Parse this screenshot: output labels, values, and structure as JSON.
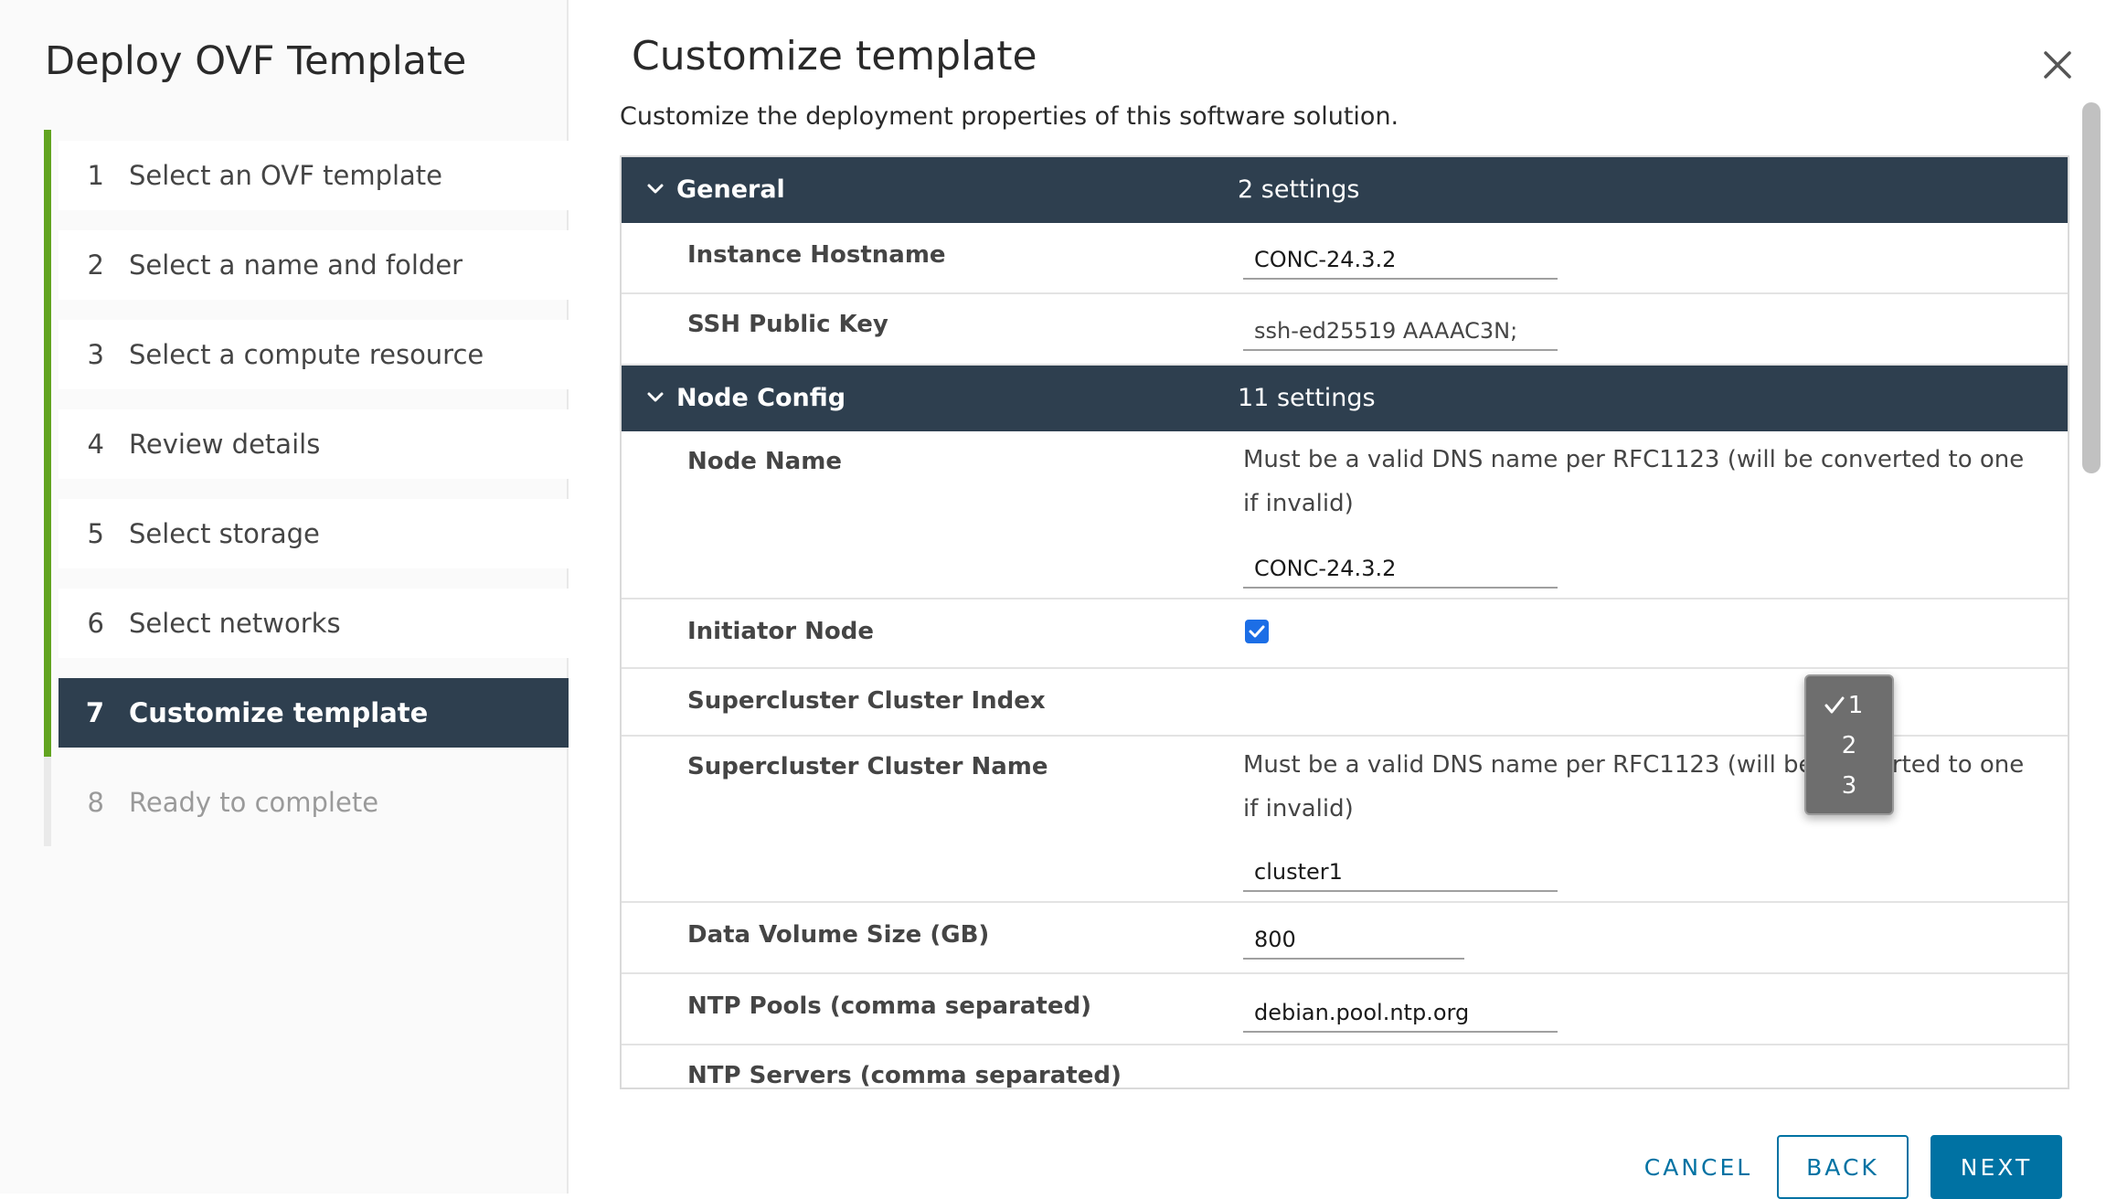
{
  "wizard": {
    "title": "Deploy OVF Template",
    "steps": [
      {
        "num": "1",
        "label": "Select an OVF template"
      },
      {
        "num": "2",
        "label": "Select a name and folder"
      },
      {
        "num": "3",
        "label": "Select a compute resource"
      },
      {
        "num": "4",
        "label": "Review details"
      },
      {
        "num": "5",
        "label": "Select storage"
      },
      {
        "num": "6",
        "label": "Select networks"
      },
      {
        "num": "7",
        "label": "Customize template"
      },
      {
        "num": "8",
        "label": "Ready to complete"
      }
    ],
    "active_step": "7"
  },
  "main": {
    "title": "Customize template",
    "description": "Customize the deployment properties of this software solution."
  },
  "groups": {
    "general": {
      "name": "General",
      "count": "2 settings",
      "rows": {
        "instance_hostname": {
          "label": "Instance Hostname",
          "value": "CONC-24.3.2"
        },
        "ssh_public_key": {
          "label": "SSH Public Key",
          "value": "ssh-ed25519 AAAAC3N;"
        }
      }
    },
    "node_config": {
      "name": "Node Config",
      "count": "11 settings",
      "rows": {
        "node_name": {
          "label": "Node Name",
          "description": "Must be a valid DNS name per RFC1123 (will be converted to one if invalid)",
          "value": "CONC-24.3.2"
        },
        "initiator_node": {
          "label": "Initiator Node",
          "checked": true
        },
        "supercluster_index": {
          "label": "Supercluster Cluster Index",
          "options": [
            "1",
            "2",
            "3"
          ],
          "selected": "1"
        },
        "supercluster_name": {
          "label": "Supercluster Cluster Name",
          "description": "Must be a valid DNS name per RFC1123 (will be converted to one if invalid)",
          "value": "cluster1"
        },
        "data_volume_size": {
          "label": "Data Volume Size (GB)",
          "value": "800"
        },
        "ntp_pools": {
          "label": "NTP Pools (comma separated)",
          "value": "debian.pool.ntp.org"
        },
        "ntp_servers": {
          "label": "NTP Servers (comma separated)"
        }
      }
    }
  },
  "footer": {
    "cancel": "CANCEL",
    "back": "BACK",
    "next": "NEXT"
  },
  "colors": {
    "header_bg": "#2e3f4f",
    "step_done": "#62a420",
    "primary": "#0072a3",
    "checkbox": "#1c6ee6"
  }
}
